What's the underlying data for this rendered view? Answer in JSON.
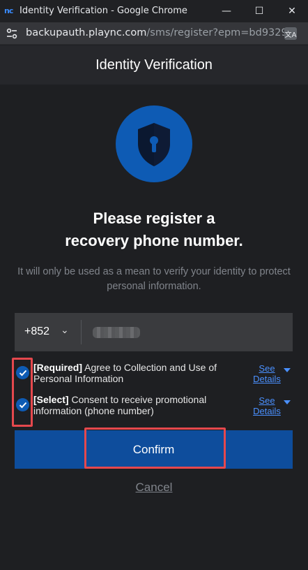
{
  "window": {
    "logo": "nc",
    "title": "Identity Verification - Google Chrome",
    "minimize_glyph": "—",
    "maximize_glyph": "☐",
    "close_glyph": "✕"
  },
  "address_bar": {
    "host": "backupauth.plaync.com",
    "path": "/sms/register?epm=bd9329...",
    "site_icon": "tune-icon",
    "translate_icon": "translate-icon"
  },
  "modal": {
    "header_title": "Identity Verification",
    "shield_icon": "shield-keyhole-icon",
    "headline_line1": "Please register a",
    "headline_line2": "recovery phone number.",
    "subtext": "It will only be used as a mean to verify your identity to protect personal information.",
    "phone": {
      "country_code": "+852",
      "chevron": "⌄",
      "number_value": ""
    },
    "agreements": [
      {
        "prefix": "[Required]",
        "text": " Agree to Collection and Use of Personal Information",
        "link_line1": "See",
        "link_line2": "Details",
        "checked": true
      },
      {
        "prefix": "[Select]",
        "text": " Consent to receive promotional information (phone number)",
        "link_line1": "See",
        "link_line2": "Details",
        "checked": true
      }
    ],
    "confirm_label": "Confirm",
    "cancel_label": "Cancel"
  },
  "colors": {
    "accent_blue": "#0e5bb4",
    "button_blue": "#0e4d9c",
    "link_blue": "#4a90ff",
    "highlight_red": "#e5484d",
    "background": "#1e1f22"
  }
}
